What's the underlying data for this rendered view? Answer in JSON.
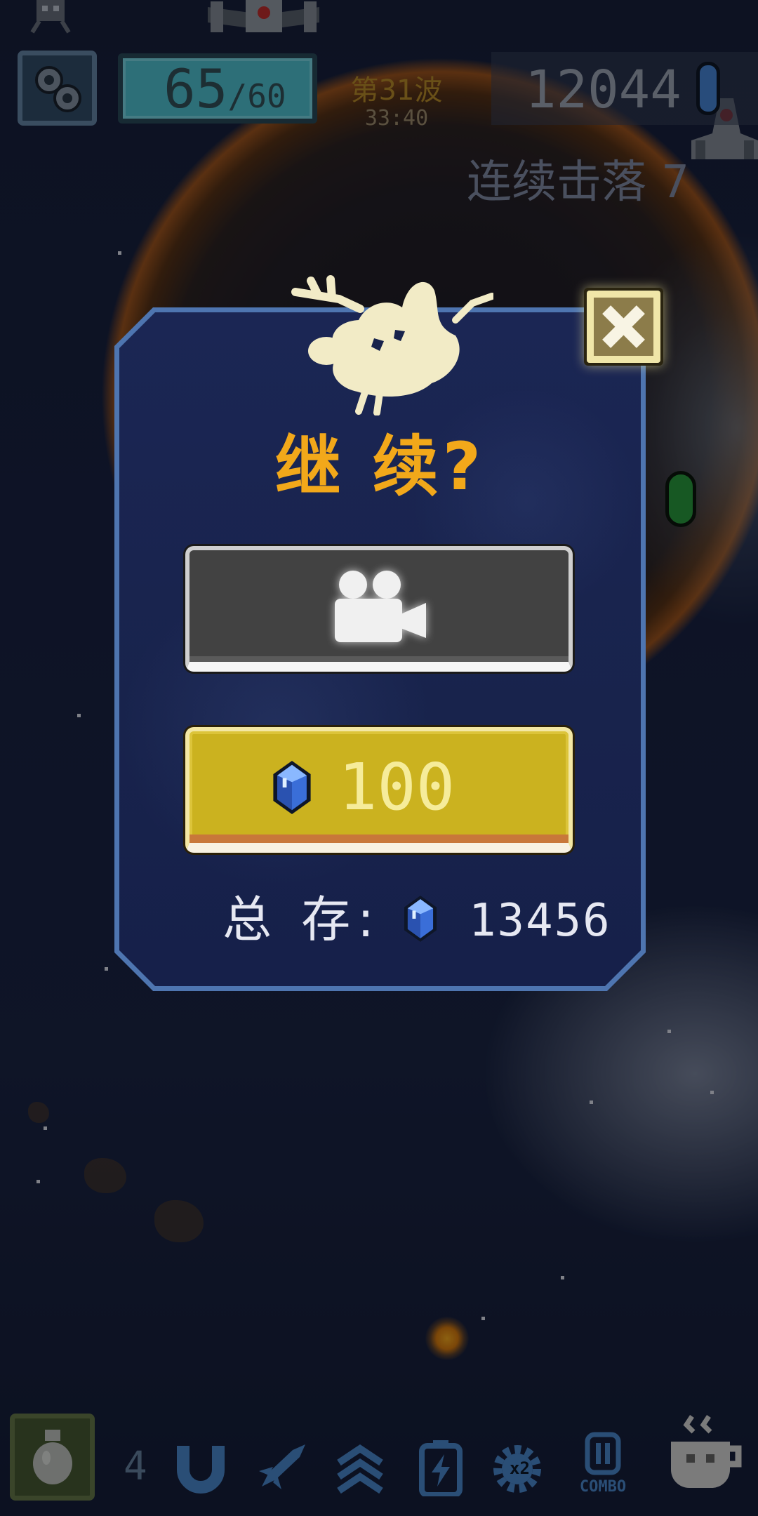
{
  "hud": {
    "hp_current": "65",
    "hp_max": "/60",
    "wave_label": "第31波",
    "timer": "33:40",
    "score": "12044",
    "combo_label": "连续击落",
    "combo_count": "7"
  },
  "dialog": {
    "title": "继 续?",
    "gem_cost": "100",
    "total_label": "总 存:",
    "total_gems": "13456"
  },
  "bottom_bar": {
    "bomb_count": "4",
    "x2_label": "x2",
    "combo_label": "COMBO"
  },
  "icons": {
    "settings": "gears-icon",
    "score_currency": "blue-capsule-icon",
    "mascot": "ghost-mascot-icon",
    "close": "close-icon",
    "video_continue": "video-camera-icon",
    "gem": "gem-icon",
    "bottom_bar": [
      "bomb-vase-icon",
      "magnet-icon",
      "missile-icon",
      "shield-wave-icon",
      "battery-lightning-icon",
      "gear-x2-icon",
      "combo-icon",
      "coffee-cup-icon"
    ]
  },
  "colors": {
    "title": "#f2a81a",
    "panel_border": "#4e75b0",
    "panel_fill": "#18234c",
    "video_button": "#424242",
    "gem_button": "#cbb21f",
    "gem_cost_text": "#f6ec9a",
    "hp_bar": "#52cadb",
    "close_button": "#f0e6a8"
  }
}
